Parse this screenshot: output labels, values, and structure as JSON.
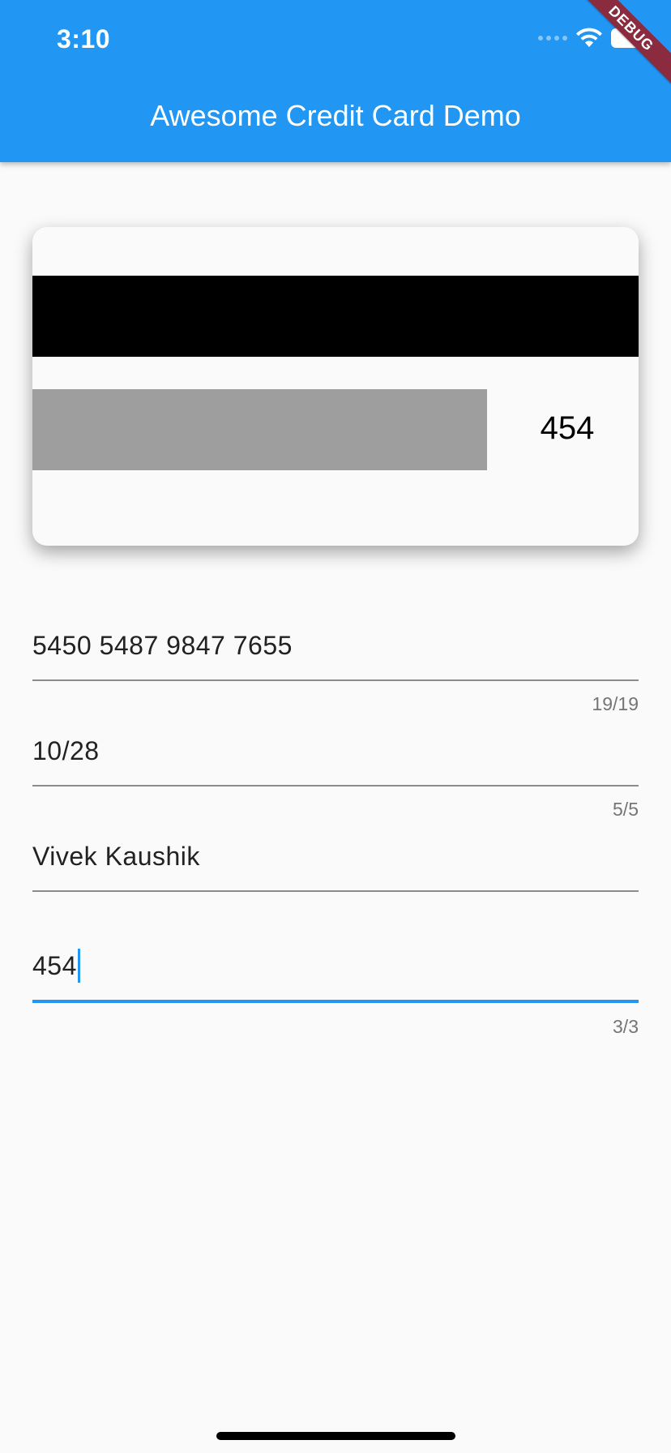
{
  "status_bar": {
    "time": "3:10",
    "icons": [
      "cellular-signal-icon",
      "wifi-icon",
      "battery-icon"
    ]
  },
  "app_bar": {
    "title": "Awesome Credit Card Demo",
    "debug_banner": "DEBUG",
    "color": "#2196f3"
  },
  "card_preview": {
    "side": "back",
    "cvv": "454",
    "stripe_color": "#000000",
    "signature_strip_color": "#9e9e9e"
  },
  "form": {
    "fields": [
      {
        "name": "card-number",
        "value": "5450 5487 9847 7655",
        "counter": "19/19",
        "focused": false
      },
      {
        "name": "expiry-date",
        "value": "10/28",
        "counter": "5/5",
        "focused": false
      },
      {
        "name": "card-holder",
        "value": "Vivek Kaushik",
        "counter": "",
        "focused": false
      },
      {
        "name": "cvv",
        "value": "454",
        "counter": "3/3",
        "focused": true
      }
    ],
    "focus_color": "#2196f3"
  }
}
